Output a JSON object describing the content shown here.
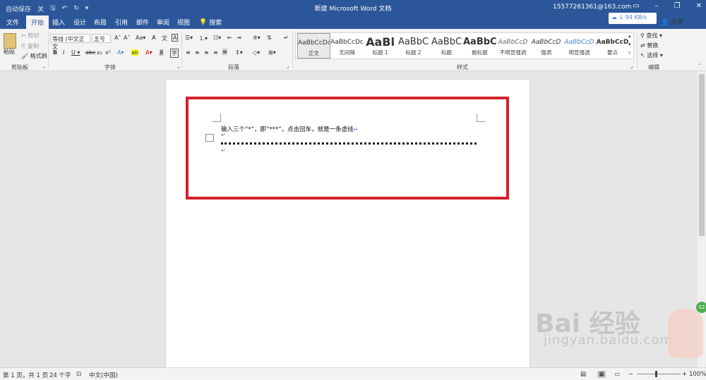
{
  "window": {
    "autosave": "自动保存",
    "autosave_state": "关",
    "title": "新建 Microsoft Word 文档",
    "user": "15577261361@163.com",
    "net_speed": "94 KB/s",
    "share": "共享"
  },
  "tabs": [
    "文件",
    "开始",
    "插入",
    "设计",
    "布局",
    "引用",
    "邮件",
    "审阅",
    "视图"
  ],
  "active_tab": "开始",
  "search_label": "搜索",
  "clipboard": {
    "paste": "粘贴",
    "cut": "剪切",
    "copy": "复制",
    "format_painter": "格式刷",
    "label": "剪贴板"
  },
  "font": {
    "name": "等线 (中文正文",
    "size": "五号",
    "label": "字体"
  },
  "paragraph": {
    "label": "段落"
  },
  "styles": {
    "label": "样式",
    "items": [
      {
        "preview": "AaBbCcDc",
        "name": "正文"
      },
      {
        "preview": "AaBbCcDc",
        "name": "无间隔"
      },
      {
        "preview": "AaBl",
        "name": "标题 1"
      },
      {
        "preview": "AaBbC",
        "name": "标题 2"
      },
      {
        "preview": "AaBbC",
        "name": "标题"
      },
      {
        "preview": "AaBbC",
        "name": "副标题"
      },
      {
        "preview": "AaBbCcD",
        "name": "不明显强调"
      },
      {
        "preview": "AaBbCcD",
        "name": "强调"
      },
      {
        "preview": "AaBbCcD",
        "name": "明显强调"
      },
      {
        "preview": "AaBbCcD",
        "name": "要点"
      }
    ]
  },
  "editing": {
    "find": "查找",
    "replace": "替换",
    "select": "选择",
    "label": "编辑"
  },
  "document": {
    "line1": "输入三个“*”，即“***”，点击回车，就是一条虚线"
  },
  "status": {
    "page": "第 1 页，共 1 页",
    "words": "24 个字",
    "language": "中文(中国)",
    "zoom": "100%"
  },
  "watermark": {
    "main": "Bai 经验",
    "sub": "jingyan.baidu.com"
  },
  "colors": {
    "brand": "#2b579a",
    "highlight_box": "#d4212a"
  }
}
